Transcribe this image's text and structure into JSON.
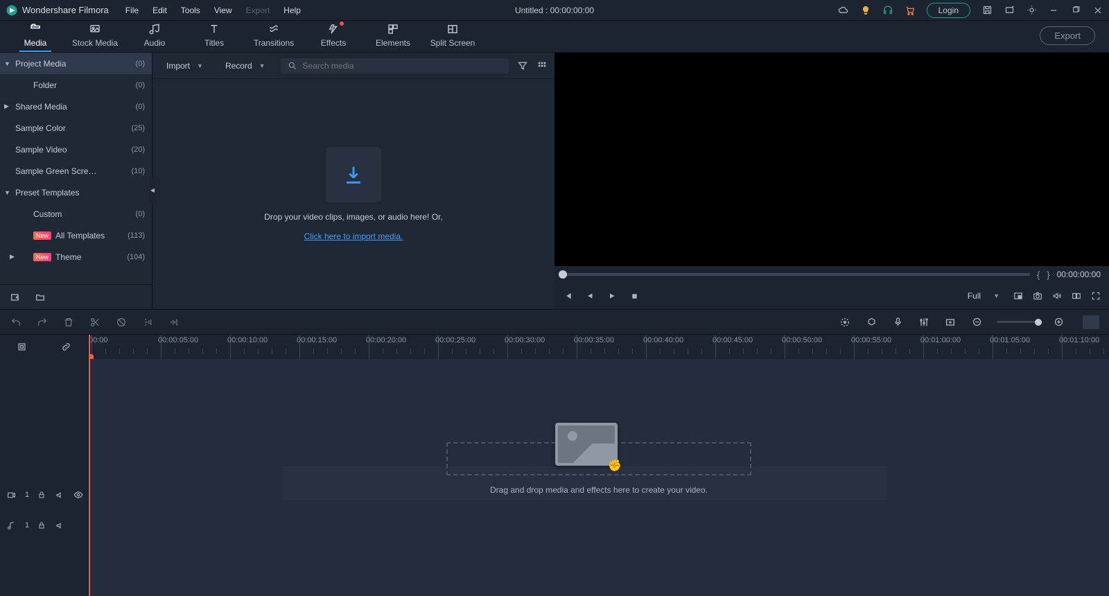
{
  "app": {
    "name": "Wondershare Filmora",
    "docTitle": "Untitled : 00:00:00:00"
  },
  "menu": [
    "File",
    "Edit",
    "Tools",
    "View",
    "Export",
    "Help"
  ],
  "menuDisabled": [
    4
  ],
  "loginLabel": "Login",
  "tabs": [
    "Media",
    "Stock Media",
    "Audio",
    "Titles",
    "Transitions",
    "Effects",
    "Elements",
    "Split Screen"
  ],
  "tabsDot": [
    5
  ],
  "exportLabel": "Export",
  "tree": [
    {
      "label": "Project Media",
      "count": "(0)",
      "arrow": "▼",
      "active": true,
      "child": false
    },
    {
      "label": "Folder",
      "count": "(0)",
      "arrow": "",
      "child": true
    },
    {
      "label": "Shared Media",
      "count": "(0)",
      "arrow": "▶",
      "child": false
    },
    {
      "label": "Sample Color",
      "count": "(25)",
      "arrow": "",
      "child": false
    },
    {
      "label": "Sample Video",
      "count": "(20)",
      "arrow": "",
      "child": false
    },
    {
      "label": "Sample Green Scre…",
      "count": "(10)",
      "arrow": "",
      "child": false
    },
    {
      "label": "Preset Templates",
      "count": "",
      "arrow": "▼",
      "child": false
    },
    {
      "label": "Custom",
      "count": "(0)",
      "arrow": "",
      "child": true
    },
    {
      "label": "All Templates",
      "count": "(113)",
      "arrow": "",
      "child": true,
      "badge": "New"
    },
    {
      "label": "Theme",
      "count": "(104)",
      "arrow": "▶",
      "child": true,
      "badge": "New",
      "arrowLeft": true
    }
  ],
  "midToolbar": {
    "import": "Import",
    "record": "Record",
    "searchPlaceholder": "Search media"
  },
  "drop": {
    "line1": "Drop your video clips, images, or audio here! Or,",
    "link": "Click here to import media."
  },
  "preview": {
    "tc": "00:00:00:00",
    "res": "Full"
  },
  "ruler": {
    "labels": [
      "00:00",
      "00:00:05:00",
      "00:00:10:00",
      "00:00:15:00",
      "00:00:20:00",
      "00:00:25:00",
      "00:00:30:00",
      "00:00:35:00",
      "00:00:40:00",
      "00:00:45:00",
      "00:00:50:00",
      "00:00:55:00",
      "00:01:00:00",
      "00:01:05:00",
      "00:01:10:00"
    ],
    "step": 100
  },
  "tracks": [
    {
      "icon": "video",
      "num": "1"
    },
    {
      "icon": "audio",
      "num": "1"
    }
  ],
  "timelineEmpty": "Drag and drop media and effects here to create your video."
}
